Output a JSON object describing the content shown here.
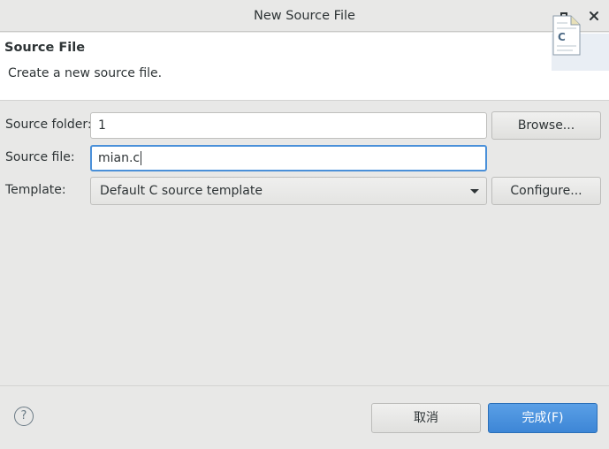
{
  "window": {
    "title": "New Source File"
  },
  "banner": {
    "heading": "Source File",
    "description": "Create a new source file.",
    "icon_letter": "C"
  },
  "form": {
    "source_folder": {
      "label": "Source folder:",
      "value": "1",
      "button": "Browse..."
    },
    "source_file": {
      "label": "Source file:",
      "value": "mian.c"
    },
    "template": {
      "label": "Template:",
      "value": "Default C source template",
      "button": "Configure..."
    }
  },
  "footer": {
    "help_glyph": "?",
    "cancel_label": "取消",
    "finish_label": "完成(F)"
  },
  "colors": {
    "primary_button": "#3d86d6",
    "focus_ring": "#4a90d9"
  }
}
